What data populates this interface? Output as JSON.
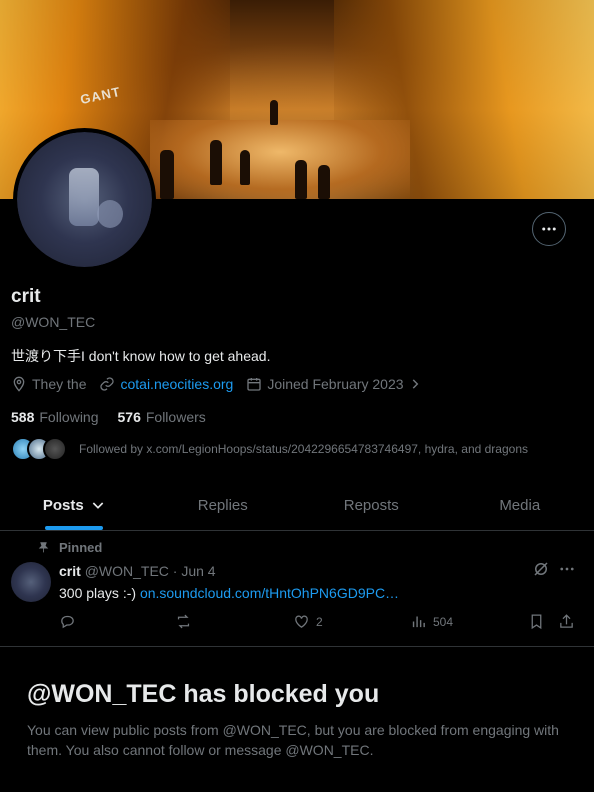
{
  "profile": {
    "name": "crit",
    "handle": "@WON_TEC",
    "bio": "世渡り下手I don't know how to get ahead.",
    "location": "They the",
    "website": "cotai.neocities.org",
    "joined": "Joined February 2023",
    "following_count": "588",
    "following_label": "Following",
    "followers_count": "576",
    "followers_label": "Followers",
    "followed_by": "Followed by x.com/LegionHoops/status/2042296654783746497, hydra, and dragons",
    "banner_sign": "GANT"
  },
  "tabs": [
    {
      "label": "Posts"
    },
    {
      "label": "Replies"
    },
    {
      "label": "Reposts"
    },
    {
      "label": "Media"
    }
  ],
  "pinned_post": {
    "pinned_label": "Pinned",
    "author": "crit",
    "handle_date": "@WON_TEC · Jun 4",
    "text": "300 plays :-)",
    "link": "on.soundcloud.com/tHntOhPN6GD9PC…",
    "likes": "2",
    "views": "504"
  },
  "blocked": {
    "title": "@WON_TEC has blocked you",
    "message": "You can view public posts from @WON_TEC, but you are blocked from engaging with them. You also cannot follow or message @WON_TEC."
  },
  "colors": {
    "accent": "#1d9bf0",
    "secondary_text": "#71767b",
    "background": "#000000"
  }
}
